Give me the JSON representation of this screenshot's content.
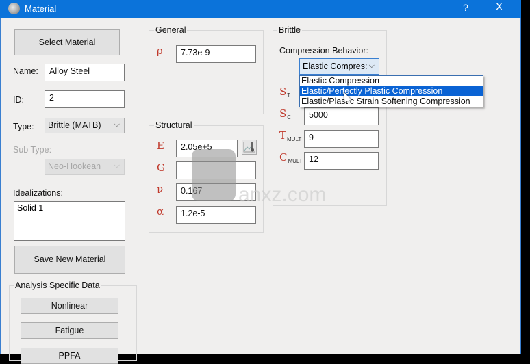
{
  "window": {
    "title": "Material",
    "help_label": "?",
    "close_label": "X",
    "icon": "material-sphere-icon"
  },
  "left_panel": {
    "select_material_label": "Select Material",
    "name_label": "Name:",
    "name_value": "Alloy Steel",
    "id_label": "ID:",
    "id_value": "2",
    "type_label": "Type:",
    "type_value": "Brittle (MATB)",
    "subtype_label": "Sub Type:",
    "subtype_value": "Neo-Hookean",
    "idealizations_label": "Idealizations:",
    "idealizations": [
      "Solid 1"
    ],
    "save_new_material_label": "Save New Material",
    "analysis_group_title": "Analysis Specific Data",
    "analysis_buttons": [
      "Nonlinear",
      "Fatigue",
      "PPFA"
    ]
  },
  "general": {
    "title": "General",
    "density_symbol": "ρ",
    "density_value": "7.73e-9"
  },
  "structural": {
    "title": "Structural",
    "fields": [
      {
        "symbol": "E",
        "value": "2.05e+5"
      },
      {
        "symbol": "G",
        "value": ""
      },
      {
        "symbol": "ν",
        "value": "0.167"
      },
      {
        "symbol": "α",
        "value": "1.2e-5"
      }
    ],
    "temp_button_icon": "temperature-curve-icon"
  },
  "brittle": {
    "title": "Brittle",
    "compression_label": "Compression Behavior:",
    "compression_value": "Elastic Compres:",
    "compression_options": [
      "Elastic Compression",
      "Elastic/Perfectly Plastic Compression",
      "Elastic/Plastic Strain Softening Compression"
    ],
    "highlighted_option_index": 1,
    "fields": [
      {
        "symbol": "S",
        "sub": "T",
        "value": ""
      },
      {
        "symbol": "S",
        "sub": "C",
        "value": "5000"
      },
      {
        "symbol": "T",
        "sub": "MULT",
        "value": "9"
      },
      {
        "symbol": "C",
        "sub": "MULT",
        "value": "12"
      }
    ]
  },
  "watermark": "anxz.com"
}
